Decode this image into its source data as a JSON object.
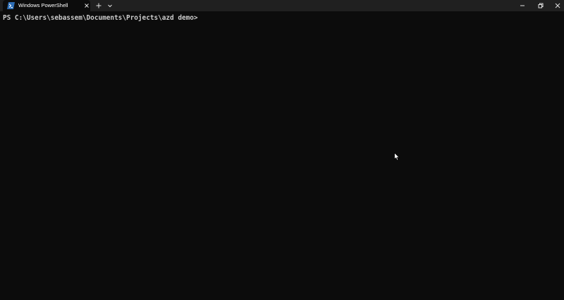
{
  "window": {
    "tab_title": "Windows PowerShell",
    "tab_icon": "powershell-icon",
    "new_tab_icon": "plus-icon",
    "dropdown_icon": "chevron-down-icon",
    "minimize_icon": "minimize-icon",
    "restore_icon": "restore-icon",
    "close_icon": "close-icon"
  },
  "terminal": {
    "prompt": "PS C:\\Users\\sebassem\\Documents\\Projects\\azd demo>"
  },
  "colors": {
    "background": "#0c0c0c",
    "titlebar": "#202020",
    "text": "#cccccc",
    "powershell_accent": "#2c6db5"
  }
}
